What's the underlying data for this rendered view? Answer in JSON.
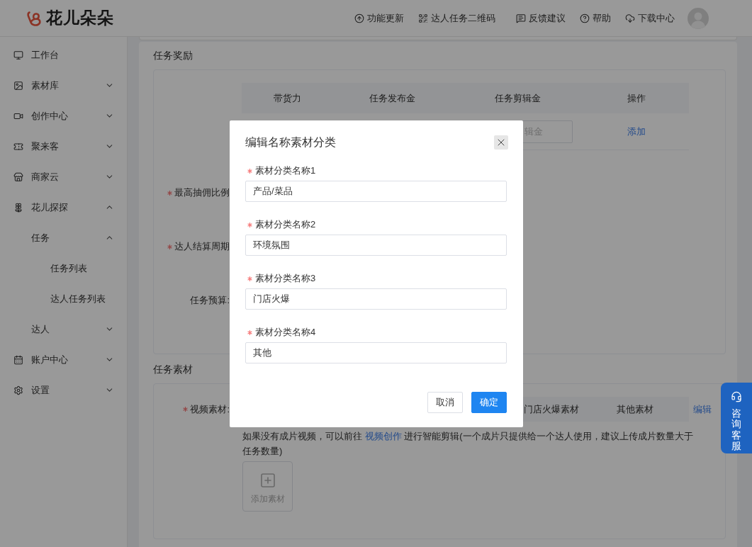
{
  "header": {
    "logo": "花儿朵朵",
    "nav": [
      {
        "label": "功能更新"
      },
      {
        "label": "达人任务二维码"
      },
      {
        "label": "反馈建议"
      },
      {
        "label": "帮助"
      },
      {
        "label": "下载中心"
      }
    ]
  },
  "sidebar": {
    "items": [
      {
        "label": "工作台"
      },
      {
        "label": "素材库",
        "expanded": false
      },
      {
        "label": "创作中心",
        "expanded": false
      },
      {
        "label": "聚来客",
        "expanded": false
      },
      {
        "label": "商家云",
        "expanded": false
      },
      {
        "label": "花儿探探",
        "expanded": true,
        "children": [
          {
            "label": "任务",
            "expanded": true,
            "children": [
              {
                "label": "任务列表"
              },
              {
                "label": "达人任务列表"
              }
            ]
          },
          {
            "label": "达人",
            "expanded": false
          }
        ]
      },
      {
        "label": "账户中心",
        "expanded": false
      },
      {
        "label": "设置",
        "expanded": false
      }
    ]
  },
  "reward_section": {
    "title": "任务奖励",
    "table": {
      "columns": [
        "带货力",
        "任务发布金",
        "任务剪辑金",
        "操作"
      ],
      "row": {
        "clip_fee_field": {
          "placeholder": "辑金"
        },
        "action": "添加"
      }
    },
    "fields": [
      {
        "label": "最高抽佣比例",
        "required": true
      },
      {
        "label": "达人结算周期",
        "required": true
      },
      {
        "label": "任务预算:",
        "required": false
      }
    ]
  },
  "material_section": {
    "title": "任务素材",
    "field": {
      "label": "视频素材:",
      "required": true
    },
    "columns": [
      "门店火爆素材",
      "其他素材"
    ],
    "edit_link": "编辑",
    "hint": {
      "before": "如果没有成片视频，可以前往",
      "link": "视频创作",
      "after": "进行智能剪辑(一个成片只提供给一个达人使用，建议上传成片数量大于任务数量)"
    },
    "upload": {
      "label": "添加素材"
    }
  },
  "support_widget": {
    "label": "咨询客服"
  },
  "dialog": {
    "title": "编辑名称素材分类",
    "fields": [
      {
        "label": "素材分类名称1",
        "value": "产品/菜品",
        "required": true
      },
      {
        "label": "素材分类名称2",
        "value": "环境氛围",
        "required": true
      },
      {
        "label": "素材分类名称3",
        "value": "门店火爆",
        "required": true
      },
      {
        "label": "素材分类名称4",
        "value": "其他",
        "required": true
      }
    ],
    "buttons": {
      "cancel": "取消",
      "confirm": "确定"
    }
  }
}
